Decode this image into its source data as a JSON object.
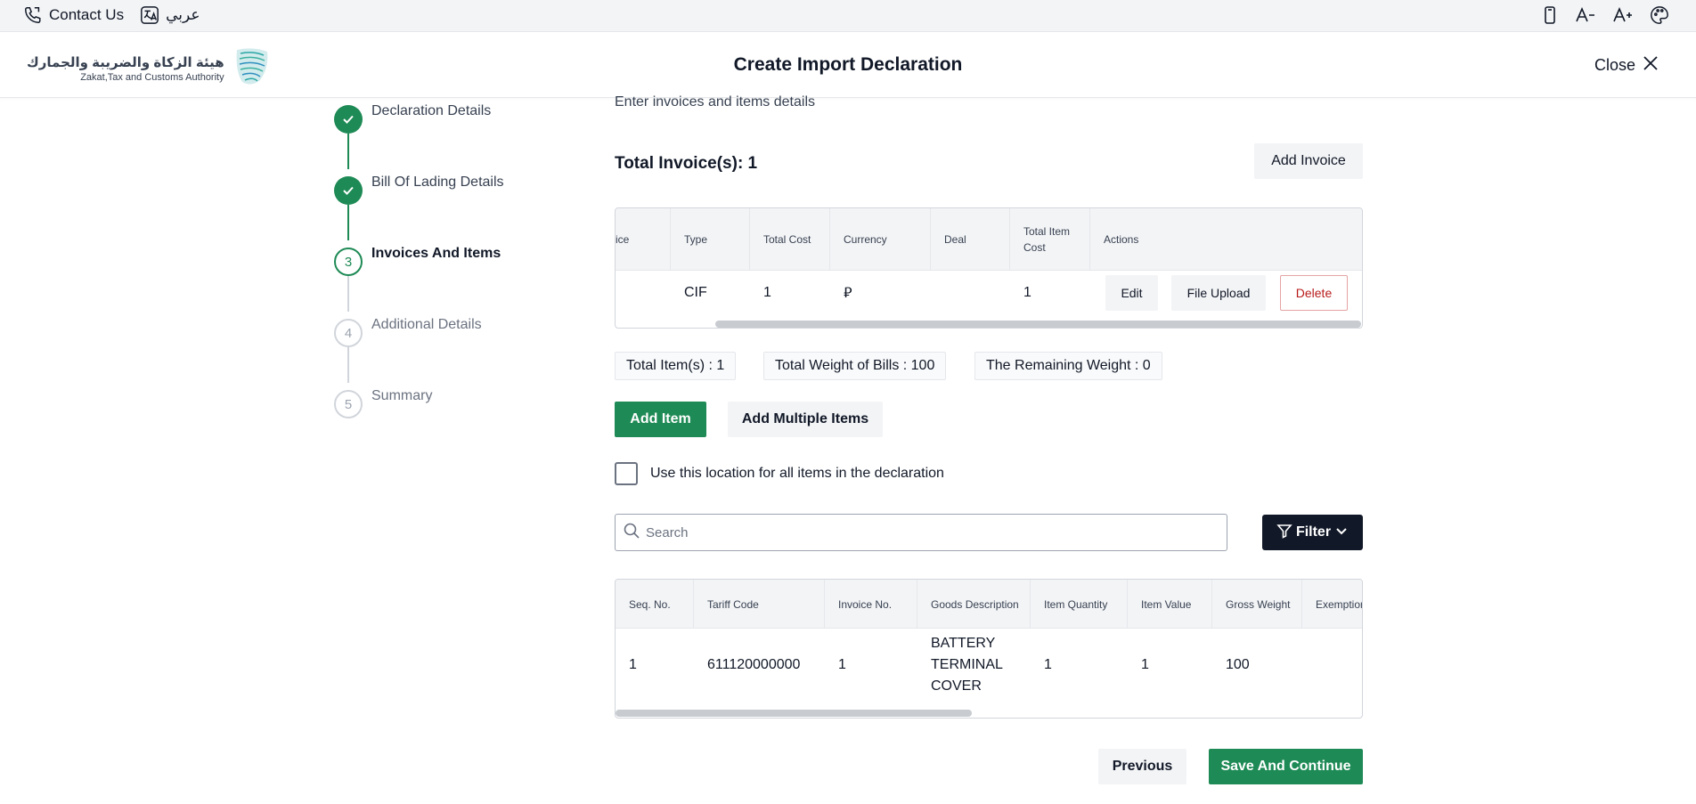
{
  "topbar": {
    "contact_label": "Contact Us",
    "language_label": "عربي",
    "icons": [
      "phone-icon",
      "translate-icon",
      "mobile-icon",
      "font-decrease-icon",
      "font-increase-icon",
      "palette-icon"
    ]
  },
  "header": {
    "logo_ar": "هيئة الزكاة والضريبة والجمارك",
    "logo_en": "Zakat,Tax and Customs Authority",
    "title": "Create Import Declaration",
    "close_label": "Close"
  },
  "stepper": {
    "steps": [
      {
        "number": "1",
        "label": "Declaration Details",
        "state": "done"
      },
      {
        "number": "2",
        "label": "Bill Of Lading Details",
        "state": "done"
      },
      {
        "number": "3",
        "label": "Invoices And Items",
        "state": "current"
      },
      {
        "number": "4",
        "label": "Additional Details",
        "state": "todo"
      },
      {
        "number": "5",
        "label": "Summary",
        "state": "todo"
      }
    ]
  },
  "main": {
    "subtitle": "Enter invoices and items details",
    "total_invoices": "Total Invoice(s): 1",
    "add_invoice_label": "Add Invoice",
    "invoice_table": {
      "headers": [
        "ice",
        "Type",
        "Total Cost",
        "Currency",
        "Deal",
        "Total Item Cost",
        "Actions"
      ],
      "row": {
        "invoice": "",
        "type": "CIF",
        "total_cost": "1",
        "currency": "⃁",
        "deal": "",
        "total_item_cost": "1"
      },
      "actions": {
        "edit": "Edit",
        "file_upload": "File Upload",
        "delete": "Delete"
      }
    },
    "summary_chips": {
      "total_items": "Total Item(s) : 1",
      "total_weight": "Total Weight of Bills : 100",
      "remaining_weight": "The Remaining Weight : 0"
    },
    "add_item_label": "Add Item",
    "add_multiple_label": "Add Multiple Items",
    "location_checkbox_label": "Use this location for all items in the declaration",
    "search_placeholder": "Search",
    "filter_label": "Filter",
    "items_table": {
      "headers": [
        "Seq. No.",
        "Tariff Code",
        "Invoice No.",
        "Goods Description",
        "Item Quantity",
        "Item Value",
        "Gross Weight",
        "Exemption"
      ],
      "rows": [
        {
          "seq": "1",
          "tariff": "611120000000",
          "invoice": "1",
          "description": "BATTERY TERMINAL COVER",
          "quantity": "1",
          "value": "1",
          "gross_weight": "100",
          "exemption": ""
        }
      ]
    },
    "previous_label": "Previous",
    "save_label": "Save And Continue"
  },
  "colors": {
    "primary_green": "#1e8a55",
    "dark_button": "#111827",
    "danger": "#b91c1c"
  }
}
